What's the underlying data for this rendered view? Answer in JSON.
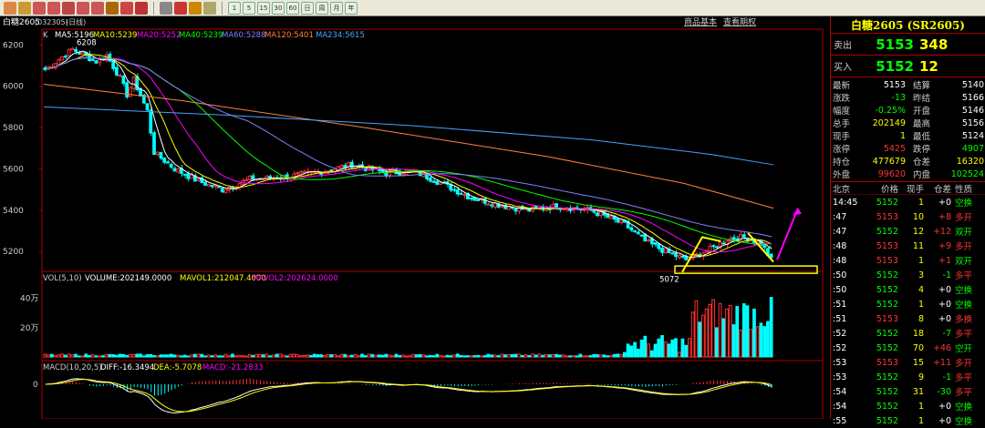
{
  "toolbar": {
    "icons": [
      "home-icon",
      "folder-icon",
      "zoom-in-icon",
      "zoom-out-icon",
      "search-icon",
      "search-plus-icon",
      "search-minus-icon",
      "config-icon",
      "filter-icon",
      "pen-icon",
      "grid-icon",
      "line-chart-icon",
      "bar-chart-icon",
      "candle-icon"
    ],
    "periods": [
      "1",
      "5",
      "15",
      "30",
      "60",
      "日",
      "周",
      "月",
      "年"
    ]
  },
  "header": {
    "symbol": "白糖2605",
    "code": "(032305)",
    "period": "(日线)",
    "links": [
      "商品基本",
      "查看期权"
    ]
  },
  "ma": {
    "k_label": "K",
    "ma5": "MA5:5196",
    "ma10": "MA10:5239",
    "ma20": "MA20:5252",
    "ma40": "MA40:5239",
    "ma60": "MA60:5288",
    "ma120": "MA120:5401",
    "ma234": "MA234:5615"
  },
  "price_axis": [
    "6200",
    "6000",
    "5800",
    "5600",
    "5400",
    "5200"
  ],
  "annotations": {
    "high": "6208",
    "low": "5072"
  },
  "volume": {
    "label": "VOL(5,10)",
    "volume": "VOLUME:202149.0000",
    "mavol1": "MAVOL1:212047.4000",
    "mavol2": "MAVOL2:202624.0000",
    "axis": [
      "40万",
      "20万"
    ]
  },
  "macd": {
    "label": "MACD(10,20,5)",
    "diff": "DIFF:-16.3494",
    "dea": "DEA:-5.7078",
    "macd": "MACD:-21.2833",
    "axis": [
      "0"
    ]
  },
  "panel": {
    "title": "白糖2605 (SR2605)",
    "ask_label": "卖出",
    "ask_price": "5153",
    "ask_vol": "348",
    "bid_label": "买入",
    "bid_price": "5152",
    "bid_vol": "12",
    "stats": [
      [
        "最新",
        "5153",
        "结算",
        "5140"
      ],
      [
        "涨跌",
        "-13",
        "昨结",
        "5166"
      ],
      [
        "幅度",
        "-0.25%",
        "开盘",
        "5146"
      ],
      [
        "总手",
        "202149",
        "最高",
        "5156"
      ],
      [
        "现手",
        "1",
        "最低",
        "5124"
      ],
      [
        "涨停",
        "5425",
        "跌停",
        "4907"
      ],
      [
        "持仓",
        "477679",
        "仓差",
        "16320"
      ],
      [
        "外盘",
        "99620",
        "内盘",
        "102524"
      ]
    ],
    "tick_header": [
      "北京",
      "价格",
      "现手",
      "仓差",
      "性质"
    ],
    "ticks": [
      [
        "14:45",
        "5152",
        "1",
        "+0",
        "空换"
      ],
      [
        ":47",
        "5153",
        "10",
        "+8",
        "多开"
      ],
      [
        ":47",
        "5152",
        "12",
        "+12",
        "双开"
      ],
      [
        ":48",
        "5153",
        "11",
        "+9",
        "多开"
      ],
      [
        ":48",
        "5153",
        "1",
        "+1",
        "双开"
      ],
      [
        ":50",
        "5152",
        "3",
        "-1",
        "多平"
      ],
      [
        ":50",
        "5152",
        "4",
        "+0",
        "空换"
      ],
      [
        ":51",
        "5152",
        "1",
        "+0",
        "空换"
      ],
      [
        ":51",
        "5153",
        "8",
        "+0",
        "多换"
      ],
      [
        ":52",
        "5152",
        "18",
        "-7",
        "多平"
      ],
      [
        ":52",
        "5152",
        "70",
        "+46",
        "空开"
      ],
      [
        ":53",
        "5153",
        "15",
        "+11",
        "多开"
      ],
      [
        ":53",
        "5152",
        "9",
        "-1",
        "多平"
      ],
      [
        ":54",
        "5152",
        "31",
        "-30",
        "多平"
      ],
      [
        ":54",
        "5152",
        "1",
        "+0",
        "空换"
      ],
      [
        ":55",
        "5152",
        "1",
        "+0",
        "空换"
      ]
    ]
  },
  "colors": {
    "up": "#ff3232",
    "down": "#00ffff",
    "ma5": "#ffffff",
    "ma10": "#ffff00",
    "ma20": "#ff00ff",
    "ma40": "#00ff00",
    "ma60": "#8080ff",
    "ma120": "#ff8040",
    "ma234": "#4aa0ff"
  }
}
